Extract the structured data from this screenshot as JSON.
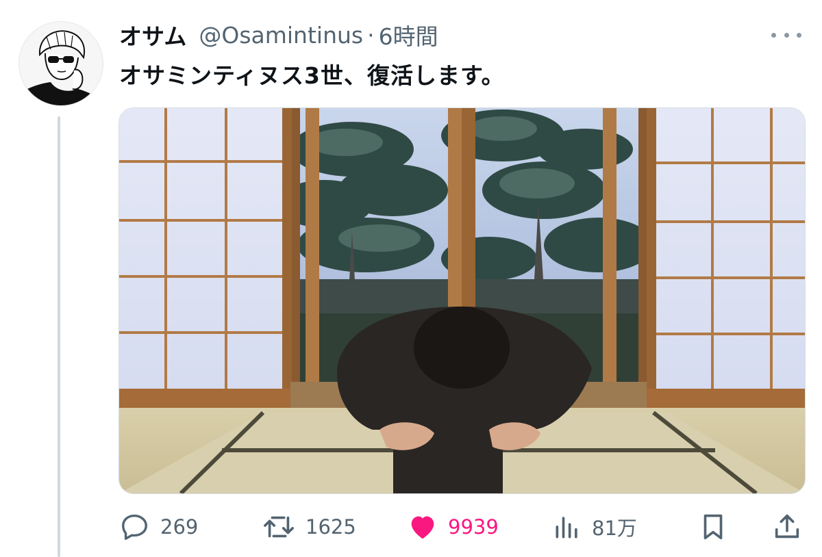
{
  "tweet": {
    "display_name": "オサム",
    "handle": "@Osamintinus",
    "separator": "·",
    "time": "6時間",
    "text": "オサミンティヌス3世、復活します。",
    "avatar_icon": "illustrated-avatar-icon",
    "more_icon": "more-dots-icon",
    "media_description_icon": "tweet-photo"
  },
  "actions": {
    "reply": {
      "icon": "reply-icon",
      "count": "269"
    },
    "retweet": {
      "icon": "retweet-icon",
      "count": "1625"
    },
    "like": {
      "icon": "heart-icon",
      "count": "9939",
      "liked": true,
      "color": "#f91880"
    },
    "views": {
      "icon": "views-icon",
      "count": "81万"
    },
    "bookmark": {
      "icon": "bookmark-icon"
    },
    "share": {
      "icon": "share-icon"
    }
  },
  "colors": {
    "text_primary": "#0f1419",
    "text_secondary": "#536471",
    "like_pink": "#f91880",
    "thread_line": "#cfd9de"
  }
}
